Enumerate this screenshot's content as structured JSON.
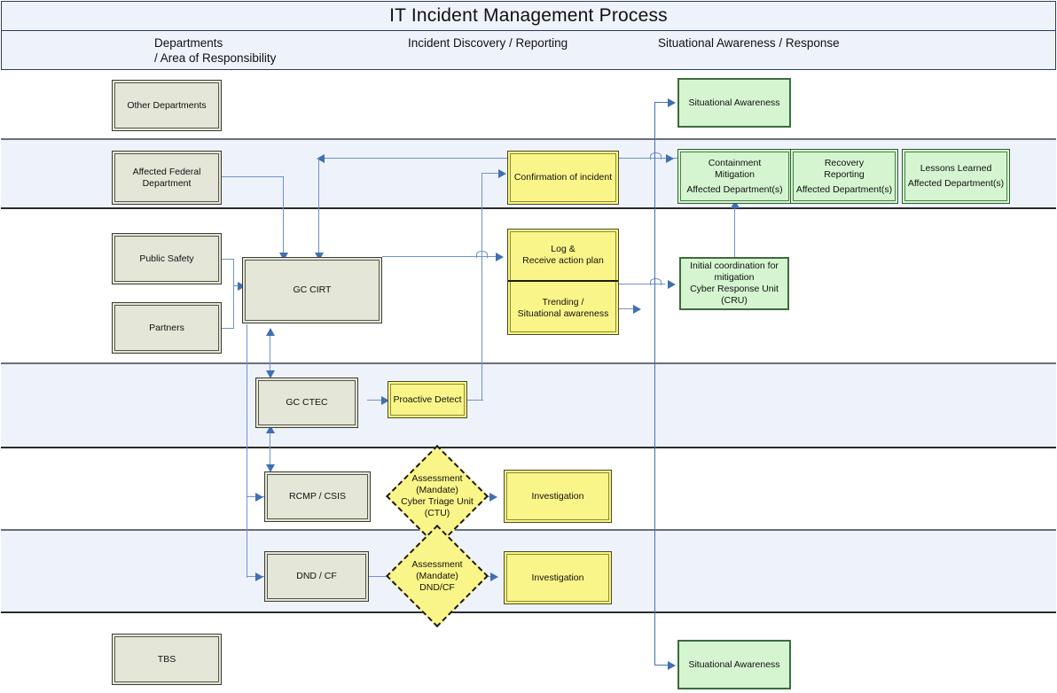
{
  "header": {
    "title": "IT Incident Management Process",
    "columns": [
      {
        "label_line1": "Departments",
        "label_line2": "/ Area of Responsibility"
      },
      {
        "label_line1": "Incident Discovery / Reporting",
        "label_line2": ""
      },
      {
        "label_line1": "Situational Awareness / Response",
        "label_line2": ""
      }
    ]
  },
  "nodes": {
    "other_departments": "Other Departments",
    "affected_federal_department": "Affected Federal\nDepartment",
    "public_safety": "Public Safety",
    "partners": "Partners",
    "gc_cirt": "GC CIRT",
    "gc_ctec": "GC CTEC",
    "rcmp_csis": "RCMP / CSIS",
    "dnd_cf": "DND / CF",
    "tbs": "TBS",
    "confirmation_of_incident": "Confirmation of incident",
    "log_receive_action_plan": "Log &\nReceive action plan",
    "trending_situational_awareness": "Trending /\nSituational awareness",
    "proactive_detect": "Proactive Detect",
    "investigation_ctu": "Investigation",
    "investigation_dnd": "Investigation",
    "situational_awareness_top": "Situational Awareness",
    "situational_awareness_bottom": "Situational Awareness",
    "containment_mitigation": "Containment\nMitigation",
    "containment_mitigation_sub": "Affected Department(s)",
    "recovery_reporting": "Recovery\nReporting",
    "recovery_reporting_sub": "Affected Department(s)",
    "lessons_learned": "Lessons Learned",
    "lessons_learned_sub": "Affected Department(s)",
    "initial_coordination": "Initial coordination for\nmitigation\nCyber Response Unit\n(CRU)"
  },
  "decisions": {
    "assessment_ctu": "Assessment\n(Mandate)\nCyber Triage Unit\n(CTU)",
    "assessment_dnd": "Assessment\n(Mandate)\nDND/CF"
  },
  "colors": {
    "band_fill": "#eef2fa",
    "header_fill": "#eef2fa",
    "gray_node": "#e4e6d7",
    "yellow_node": "#faf588",
    "green_node": "#d4f5d0",
    "connector": "#6f91d4",
    "arrowhead": "#3f6fb5"
  }
}
